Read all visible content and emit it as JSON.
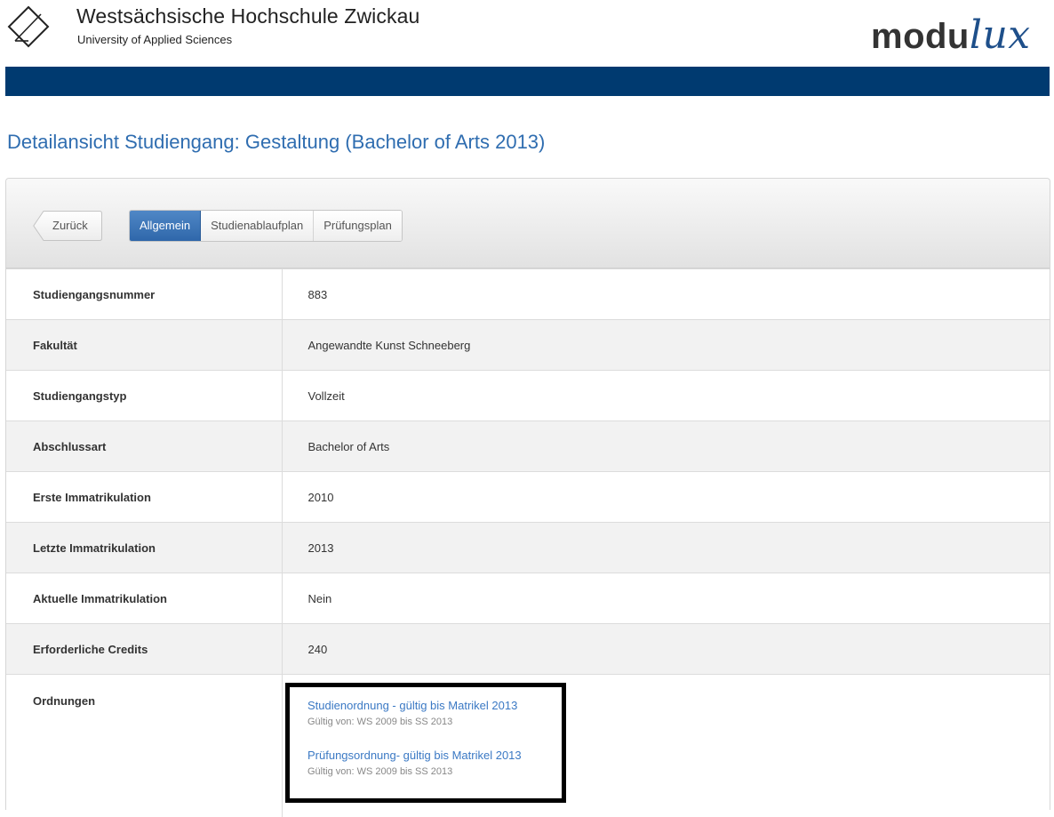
{
  "header": {
    "school_name": "Westsächsische Hochschule Zwickau",
    "school_subtitle": "University of Applied Sciences",
    "brand_main": "modu",
    "brand_accent": "lux",
    "bar_color": "#003a70"
  },
  "page_title": "Detailansicht Studiengang: Gestaltung (Bachelor of Arts 2013)",
  "toolbar": {
    "back_label": "Zurück",
    "tabs": [
      {
        "label": "Allgemein",
        "active": true
      },
      {
        "label": "Studienablaufplan",
        "active": false
      },
      {
        "label": "Prüfungsplan",
        "active": false
      }
    ]
  },
  "details": [
    {
      "label": "Studiengangsnummer",
      "value": "883"
    },
    {
      "label": "Fakultät",
      "value": "Angewandte Kunst Schneeberg"
    },
    {
      "label": "Studiengangstyp",
      "value": "Vollzeit"
    },
    {
      "label": "Abschlussart",
      "value": "Bachelor of Arts"
    },
    {
      "label": "Erste Immatrikulation",
      "value": "2010"
    },
    {
      "label": "Letzte Immatrikulation",
      "value": "2013"
    },
    {
      "label": "Aktuelle Immatrikulation",
      "value": "Nein"
    },
    {
      "label": "Erforderliche Credits",
      "value": "240"
    }
  ],
  "ordnungen": {
    "label": "Ordnungen",
    "items": [
      {
        "link": "Studienordnung - gültig bis Matrikel 2013",
        "validity": "Gültig von: WS 2009 bis SS 2013"
      },
      {
        "link": "Prüfungsordnung- gültig bis Matrikel 2013",
        "validity": "Gültig von: WS 2009 bis SS 2013"
      }
    ]
  }
}
